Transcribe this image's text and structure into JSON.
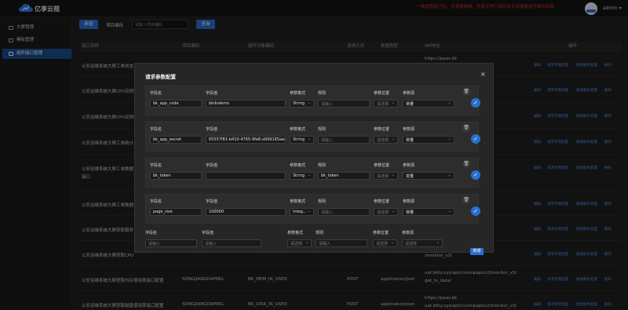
{
  "app": {
    "logo_name": "cloud-logo",
    "title": "亿享云视"
  },
  "header": {
    "marquee": "一味的固执己见，无滴者微绩，狂笑无声已保存名无法掩盖这可笑的自尊",
    "user": "admin",
    "dropdown_icon": "caret-down-icon"
  },
  "sidebar": {
    "items": [
      {
        "label": "大屏管理",
        "icon": "monitor-icon",
        "active": false
      },
      {
        "label": "模板管理",
        "icon": "template-icon",
        "active": false
      },
      {
        "label": "组件接口管理",
        "icon": "interface-icon",
        "active": true
      }
    ]
  },
  "toolbar": {
    "add_label": "新增",
    "code_label": "项目编码",
    "code_placeholder": "请输入项目编码",
    "search_label": "查询"
  },
  "table": {
    "headers": [
      "接口名称",
      "项目编码",
      "组件对象编码",
      "请求方式",
      "数据类型",
      "API地址",
      "操作"
    ],
    "ops": [
      "编辑",
      "请求参数配置",
      "数据解析配置",
      "删除"
    ],
    "rows": [
      {
        "name": "公安运维系统大屏工单状态",
        "code": "",
        "obj": "",
        "method": "",
        "type": "",
        "api": [
          "https://paas.bk",
          "/itsm/get_tic"
        ]
      },
      {
        "name": "公安运维系统大屏CPU实例使用",
        "code": "",
        "obj": "",
        "method": "",
        "type": "",
        "api": [
          "",
          "/monitor_v3/"
        ]
      },
      {
        "name": "公安运维系统大屏CPU实例使用",
        "code": "",
        "obj": "",
        "method": "",
        "type": "",
        "api": [
          "",
          "/monitor_v3/"
        ]
      },
      {
        "name": "公安运维系统大屏工单统计",
        "code": "",
        "obj": "",
        "method": "",
        "type": "",
        "api": [
          "",
          "/itsm/get_tic"
        ]
      },
      {
        "name": "公安运维系统大屏工单数据",
        "code": "",
        "obj": "",
        "method": "",
        "type": "",
        "api": [
          "",
          "/itsm/get_tic"
        ],
        "extra": "接口"
      },
      {
        "name": "公安运维系统大屏工单数据",
        "code": "",
        "obj": "",
        "method": "",
        "type": "",
        "api": [
          "",
          "/itsm/get_tic"
        ]
      },
      {
        "name": "公安运维系统大屏获取服务",
        "code": "",
        "obj": "",
        "method": "",
        "type": "",
        "api": [
          "",
          "/monitor_v3/"
        ]
      },
      {
        "name": "公安运维系统大屏获取CPU",
        "code": "",
        "obj": "",
        "method": "",
        "type": "",
        "api": [
          "",
          "/monitor_v3/"
        ]
      },
      {
        "name": "公安运维系统大屏获取内存使用率接口配置",
        "code": "SONGJIANGDAPING",
        "obj": "BK_MEM_IN_USED",
        "method": "POST",
        "type": "application/json",
        "api": [
          "uat.bkty.xyz/api/c/compapi/v2/monitor_v3/",
          "get_ts_data/"
        ]
      },
      {
        "name": "公安运维系统大屏获取磁盘使用率接口配置",
        "code": "SONGJIANGDAPING",
        "obj": "BK_DISK_IN_USED",
        "method": "POST",
        "type": "application/json",
        "api": [
          "https://paas.bk",
          "uat.bkty.xyz/api/c/compapi/v2/monitor_v3/"
        ]
      }
    ]
  },
  "dialog": {
    "title": "请求参数配置",
    "labels": {
      "name": "字段名",
      "value": "字段值",
      "format": "参数格式",
      "rule": "规则",
      "position": "参数位置",
      "source": "参数源"
    },
    "placeholders": {
      "input": "请输入",
      "select": "请选择"
    },
    "rows": [
      {
        "name": "bk_app_code",
        "value": "bkdsdemo",
        "format": "String",
        "rule": "",
        "position": "",
        "source": "常量"
      },
      {
        "name": "bk_app_secret",
        "value": "65557f81-b410-4765-9fe8-a699165aeaf",
        "format": "String",
        "rule": "",
        "position": "",
        "source": "常量"
      },
      {
        "name": "bk_token",
        "value": "",
        "format": "String",
        "rule": "bk_token",
        "position": "",
        "source": "变量"
      },
      {
        "name": "page_size",
        "value": "100000",
        "format": "Integ...",
        "rule": "",
        "position": "",
        "source": "常量"
      }
    ],
    "add_label": "新增",
    "close_icon": "close-icon"
  }
}
